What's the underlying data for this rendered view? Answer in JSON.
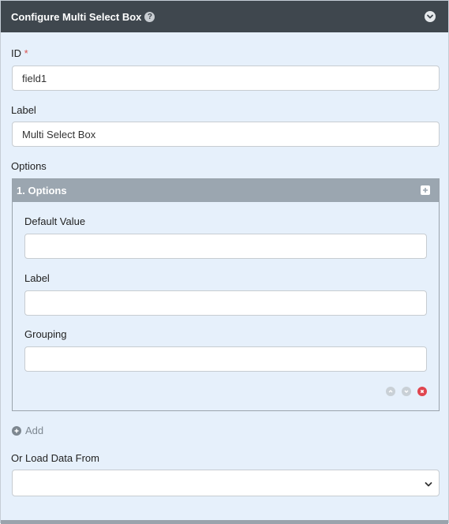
{
  "header": {
    "title": "Configure Multi Select Box",
    "help_glyph": "?"
  },
  "form": {
    "id_label": "ID",
    "id_required_mark": "*",
    "id_value": "field1",
    "label_label": "Label",
    "label_value": "Multi Select Box",
    "options_label": "Options"
  },
  "option_item": {
    "title": "1. Options",
    "default_value_label": "Default Value",
    "default_value": "",
    "label_label": "Label",
    "label_value": "",
    "grouping_label": "Grouping",
    "grouping_value": ""
  },
  "add_label": "Add",
  "load_data": {
    "label": "Or Load Data From",
    "selected": ""
  },
  "icons": {
    "collapse": "chevron-down-circle-icon",
    "help": "question-circle-icon",
    "expand": "plus-square-icon",
    "move_up": "chevron-up-circle-icon",
    "move_down": "chevron-down-circle-icon",
    "remove": "x-circle-icon",
    "add": "plus-circle-icon",
    "select": "chevron-down-icon"
  },
  "colors": {
    "header_bg": "#3f474e",
    "panel_bg": "#e6f0fb",
    "sub_header_bg": "#9ba6b0",
    "required": "#d9534f",
    "remove": "#e0454f",
    "muted": "#7d8790"
  }
}
